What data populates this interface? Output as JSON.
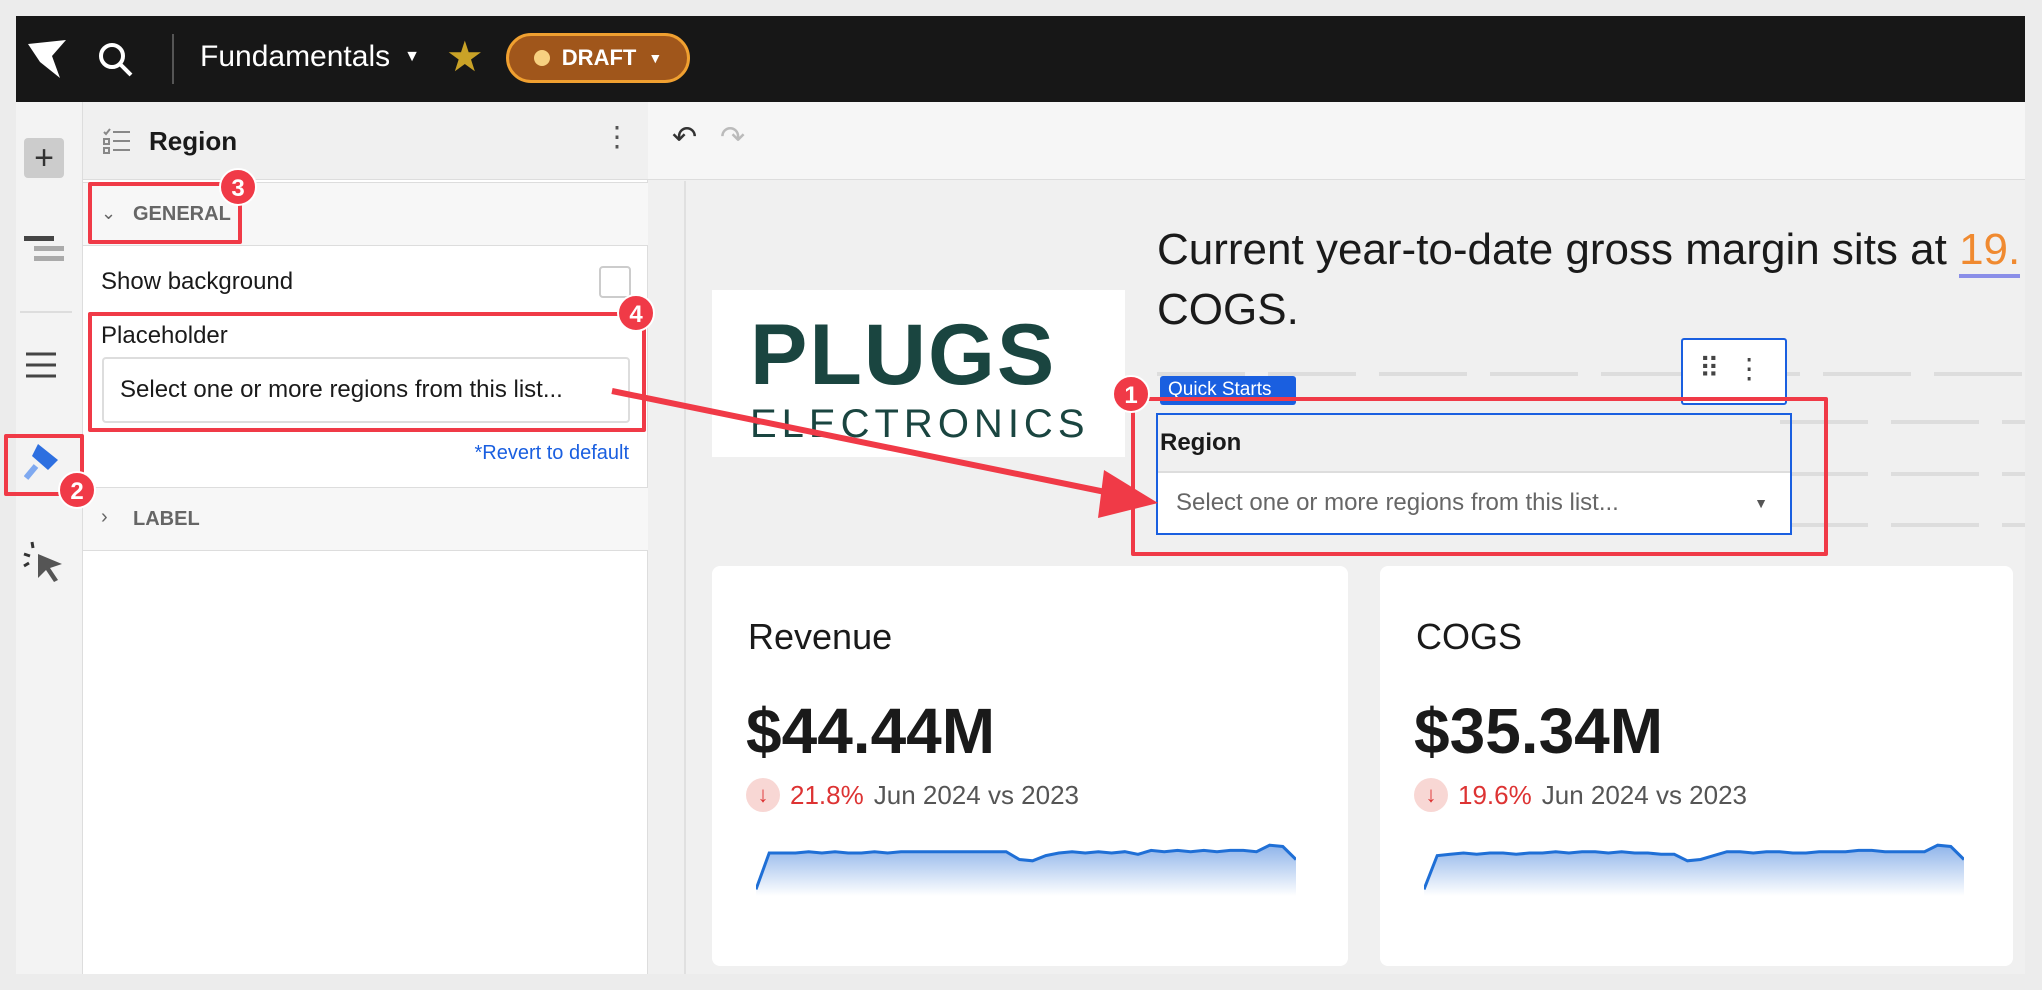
{
  "topbar": {
    "workbook_title": "Fundamentals",
    "status_label": "DRAFT",
    "colors": {
      "draft_bg": "#a0561b",
      "draft_border": "#f0a030",
      "star": "#c9a227"
    }
  },
  "panel": {
    "title": "Region",
    "sections": {
      "general": "GENERAL",
      "label": "LABEL"
    },
    "show_background_label": "Show background",
    "placeholder_label": "Placeholder",
    "placeholder_value": "Select one or more regions from this list...",
    "revert_link": "*Revert to default"
  },
  "canvas": {
    "headline_line1": "Current year-to-date gross margin sits at ",
    "headline_highlight": "19.",
    "headline_line2": "COGS.",
    "logo_text_top": "PLUGS",
    "logo_text_bottom": "ELECTRONICS",
    "quick_starts_tag": "Quick Starts",
    "control": {
      "label": "Region",
      "placeholder": "Select one or more regions from this list..."
    }
  },
  "cards": [
    {
      "title": "Revenue",
      "value": "$44.44M",
      "delta": "21.8%",
      "comparison": "Jun 2024 vs 2023",
      "trend": [
        2,
        30,
        30,
        30,
        31,
        30,
        31,
        30,
        30,
        31,
        30,
        31,
        31,
        31,
        31,
        31,
        31,
        31,
        31,
        31,
        25,
        24,
        28,
        30,
        31,
        30,
        31,
        30,
        31,
        29,
        32,
        31,
        32,
        31,
        32,
        31,
        32,
        32,
        31,
        36,
        35,
        25
      ]
    },
    {
      "title": "COGS",
      "value": "$35.34M",
      "delta": "19.6%",
      "comparison": "Jun 2024 vs 2023",
      "trend": [
        2,
        28,
        29,
        30,
        29,
        30,
        30,
        29,
        30,
        30,
        31,
        30,
        31,
        31,
        30,
        31,
        30,
        30,
        29,
        29,
        24,
        25,
        28,
        31,
        31,
        30,
        31,
        31,
        30,
        30,
        31,
        31,
        31,
        32,
        32,
        31,
        31,
        31,
        31,
        36,
        35,
        25
      ]
    }
  ],
  "annotations": [
    "1",
    "2",
    "3",
    "4"
  ]
}
